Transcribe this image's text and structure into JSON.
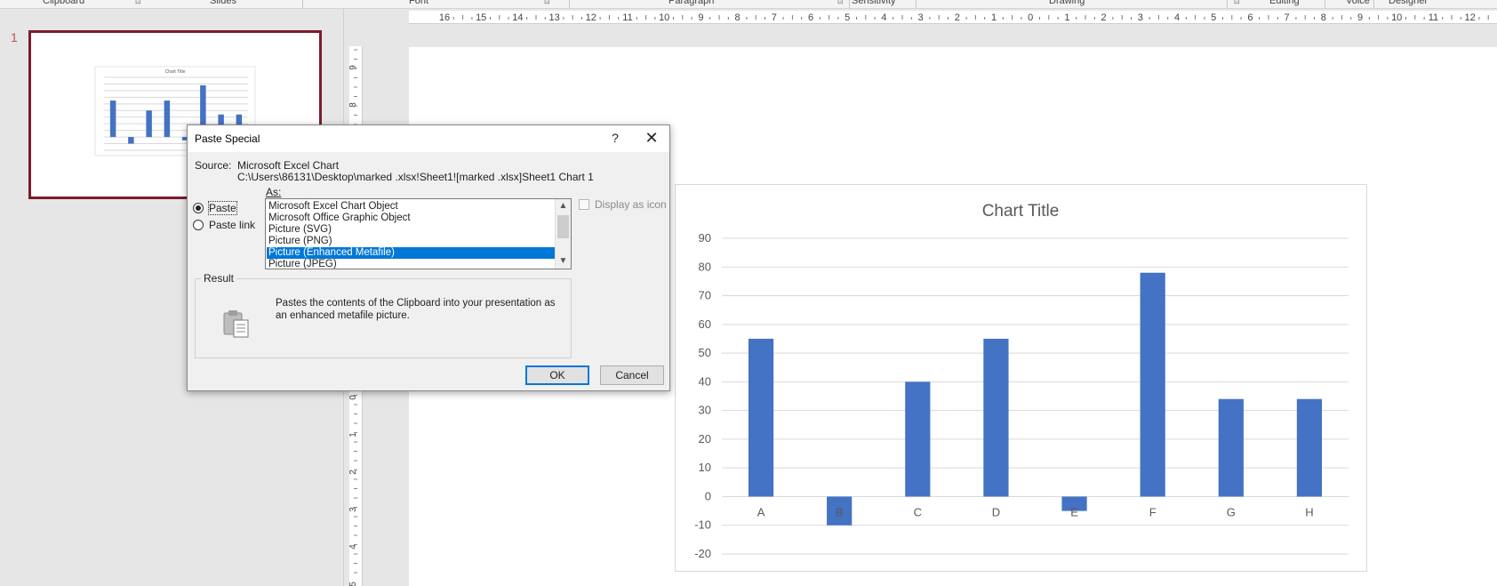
{
  "ribbon": {
    "groups": [
      {
        "label": "Clipboard",
        "launcher": true
      },
      {
        "label": "Slides",
        "launcher": false
      },
      {
        "label": "Font",
        "launcher": true
      },
      {
        "label": "Paragraph",
        "launcher": true
      },
      {
        "label": "Sensitivity",
        "launcher": false
      },
      {
        "label": "Drawing",
        "launcher": true
      },
      {
        "label": "Editing",
        "launcher": false
      },
      {
        "label": "Voice",
        "launcher": false
      },
      {
        "label": "Designer",
        "launcher": false
      }
    ],
    "launcher_glyph": "⊡"
  },
  "slides": {
    "current_number": "1",
    "thumbnail_title": "Chart Title"
  },
  "rulers": {
    "horizontal": [
      "16",
      "15",
      "14",
      "13",
      "12",
      "11",
      "10",
      "9",
      "8",
      "7",
      "6",
      "5",
      "4",
      "3",
      "2",
      "1",
      "0",
      "1",
      "2",
      "3",
      "4",
      "5",
      "6",
      "7",
      "8",
      "9",
      "10",
      "11",
      "12"
    ],
    "vertical_top": [
      "9",
      "8",
      "7"
    ],
    "vertical_bottom": [
      "0",
      "1",
      "2",
      "3",
      "4",
      "5"
    ]
  },
  "dialog": {
    "title": "Paste Special",
    "help_glyph": "?",
    "close_glyph": "✕",
    "source_label": "Source:",
    "source_name": "Microsoft Excel Chart",
    "source_path": "C:\\Users\\86131\\Desktop\\marked .xlsx!Sheet1![marked .xlsx]Sheet1 Chart 1",
    "as_label": "As:",
    "paste_label": "Paste",
    "paste_link_label": "Paste link",
    "paste_selected": true,
    "formats": [
      "Microsoft Excel Chart Object",
      "Microsoft Office Graphic Object",
      "Picture (SVG)",
      "Picture (PNG)",
      "Picture (Enhanced Metafile)",
      "Picture (JPEG)"
    ],
    "selected_format": "Picture (Enhanced Metafile)",
    "display_as_icon_label": "Display as icon",
    "display_as_icon_checked": false,
    "result_label": "Result",
    "result_text": "Pastes the contents of the Clipboard into your presentation as an enhanced metafile picture.",
    "ok_label": "OK",
    "cancel_label": "Cancel"
  },
  "colors": {
    "bar": "#4472c4",
    "selection": "#0078d7",
    "thumb_border": "#7b1c2b"
  },
  "chart_data": {
    "type": "bar",
    "title": "Chart Title",
    "categories": [
      "A",
      "B",
      "C",
      "D",
      "E",
      "F",
      "G",
      "H"
    ],
    "values": [
      55,
      -10,
      40,
      55,
      -5,
      78,
      34,
      34
    ],
    "ylim": [
      -20,
      90
    ],
    "yticks": [
      90,
      80,
      70,
      60,
      50,
      40,
      30,
      20,
      10,
      0,
      -10,
      -20
    ],
    "grid": true,
    "legend": "none"
  }
}
